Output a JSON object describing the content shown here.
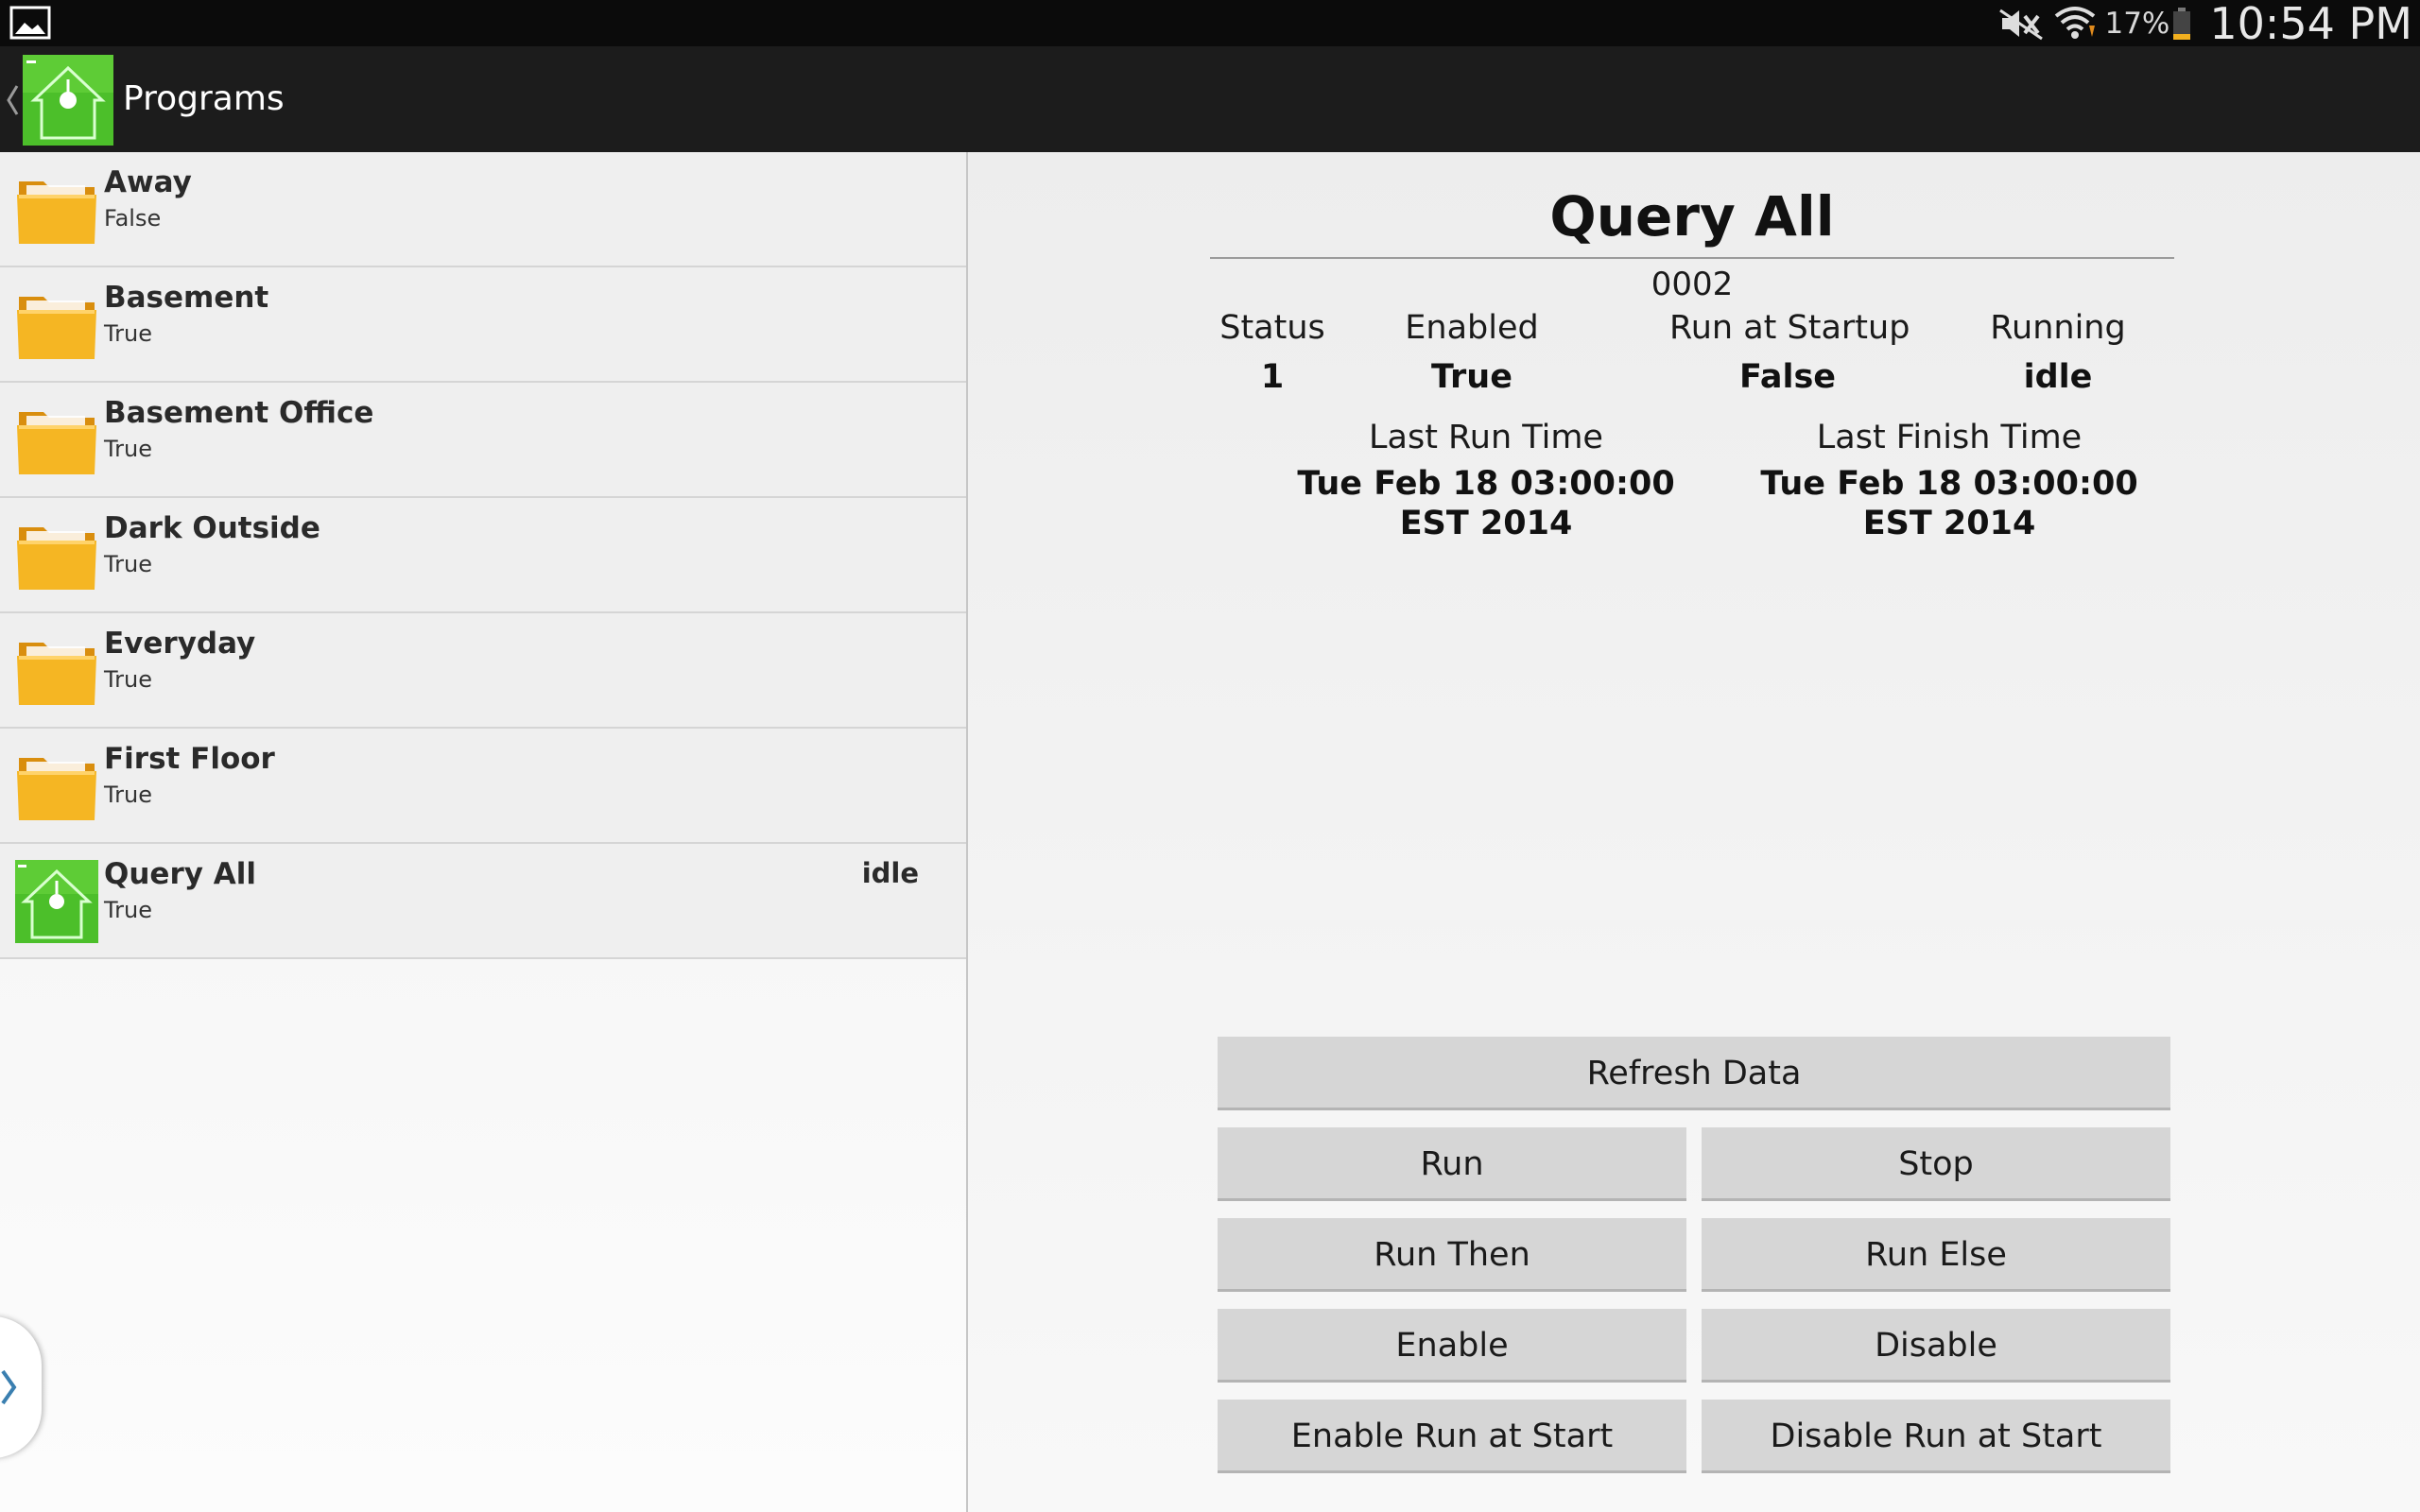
{
  "status_bar": {
    "battery_percent": "17%",
    "time": "10:54 PM",
    "icons": [
      "gallery-icon",
      "mute-icon",
      "wifi-icon",
      "battery-icon"
    ]
  },
  "action_bar": {
    "title": "Programs",
    "app_icon": "home-lightbulb-icon"
  },
  "program_list": [
    {
      "name": "Away",
      "value": "False",
      "status": "",
      "icon": "folder-icon"
    },
    {
      "name": "Basement",
      "value": "True",
      "status": "",
      "icon": "folder-icon"
    },
    {
      "name": "Basement Office",
      "value": "True",
      "status": "",
      "icon": "folder-icon"
    },
    {
      "name": "Dark Outside",
      "value": "True",
      "status": "",
      "icon": "folder-icon"
    },
    {
      "name": "Everyday",
      "value": "True",
      "status": "",
      "icon": "folder-icon"
    },
    {
      "name": "First Floor",
      "value": "True",
      "status": "",
      "icon": "folder-icon"
    },
    {
      "name": "Query All",
      "value": "True",
      "status": "idle",
      "icon": "program-icon"
    }
  ],
  "detail": {
    "title": "Query All",
    "id": "0002",
    "stats": [
      {
        "label": "Status",
        "value": "1"
      },
      {
        "label": "Enabled",
        "value": "True"
      },
      {
        "label": "Run at Startup",
        "value": "False"
      },
      {
        "label": "Running",
        "value": "idle"
      }
    ],
    "last_run": {
      "label": "Last Run Time",
      "value": "Tue Feb 18 03:00:00 EST 2014"
    },
    "last_finish": {
      "label": "Last Finish Time",
      "value": "Tue Feb 18 03:00:00 EST 2014"
    }
  },
  "buttons": {
    "refresh": "Refresh Data",
    "run": "Run",
    "stop": "Stop",
    "run_then": "Run Then",
    "run_else": "Run Else",
    "enable": "Enable",
    "disable": "Disable",
    "enable_run_at_start": "Enable Run at Start",
    "disable_run_at_start": "Disable Run at Start"
  },
  "colors": {
    "status_bar_bg": "#0b0b0b",
    "action_bar_bg": "#1c1c1c",
    "folder_yellow": "#f5b623",
    "logo_green": "#4cbf2a",
    "button_bg": "#d6d6d6",
    "drawer_chevron": "#3a7fb0"
  }
}
